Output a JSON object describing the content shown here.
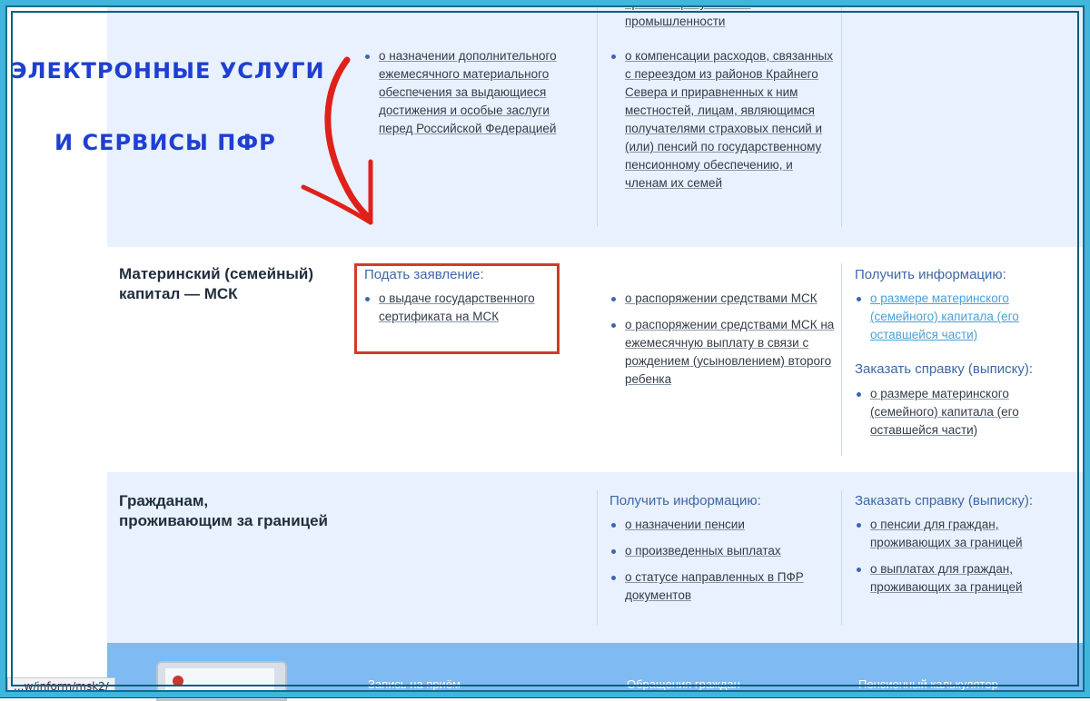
{
  "overlay": {
    "line1": "ЭЛЕКТРОННЫЕ УСЛУГИ",
    "line2": "И СЕРВИСЫ ПФР"
  },
  "section1": {
    "col2_items": [
      "о назначении дополнительного ежемесячного материального обеспечения за выдающиеся достижения и особые заслуги перед Российской Федерацией"
    ],
    "col3_top": "организаций угольной промышленности",
    "col3_items": [
      "о компенсации расходов, связанных с переездом из районов Крайнего Севера и приравненных к ним местностей, лицам, являющимся получателями страховых пенсий и (или) пенсий по государственному пенсионному обеспечению, и членам их семей"
    ]
  },
  "section2": {
    "title_line1": "Материнский (семейный)",
    "title_line2": "капитал — МСК",
    "apply_header": "Подать заявление:",
    "apply_items": [
      "о выдаче государственного сертификата на МСК"
    ],
    "col3_items": [
      "о распоряжении средствами МСК",
      "о распоряжении средствами МСК на ежемесячную выплату в связи с рождением (усыновлением) второго ребенка"
    ],
    "info_header": "Получить информацию:",
    "info_items": [
      "о размере материнского (семейного) капитала (его оставшейся части)"
    ],
    "order_header": "Заказать справку (выписку):",
    "order_items": [
      "о размере материнского (семейного) капитала (его оставшейся части)"
    ]
  },
  "section3": {
    "title_line1": "Гражданам,",
    "title_line2": "проживающим за границей",
    "info_header": "Получить информацию:",
    "info_items": [
      "о назначении пенсии",
      "о произведенных выплатах",
      "о статусе направленных в ПФР документов"
    ],
    "order_header": "Заказать справку (выписку):",
    "order_items": [
      "о пенсии для граждан, проживающих за границей",
      "о выплатах для граждан, проживающих за границей"
    ]
  },
  "section4": {
    "links": [
      "Запись на приём",
      "Обращения граждан",
      "Пенсионный калькулятор"
    ]
  },
  "status_url": "...w/inform/msk2/",
  "colors": {
    "section_bg": "#e8f1fd",
    "header_blue": "#3e67a8",
    "overlay_blue": "#1f3fd0",
    "highlight_red": "#d23a2b",
    "frame": "#3fb6dc",
    "bottom_band": "#7fbaf2"
  }
}
